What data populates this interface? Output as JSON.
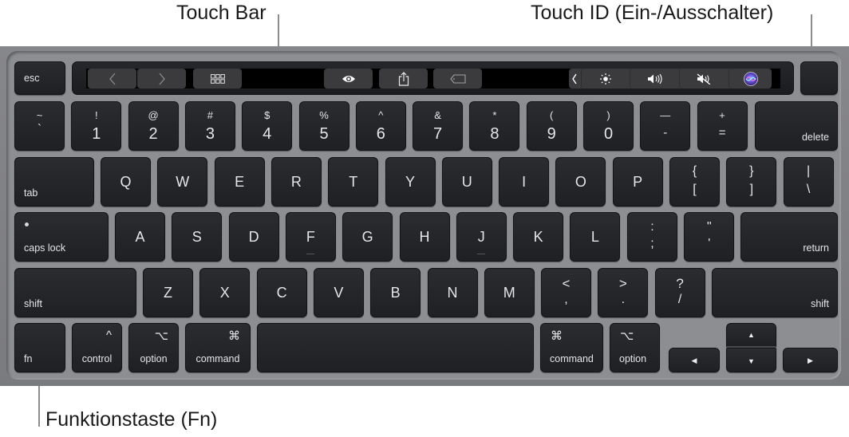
{
  "callouts": {
    "touch_bar": "Touch Bar",
    "touch_id": "Touch ID (Ein-/Ausschalter)",
    "fn_key": "Funktionstaste (Fn)"
  },
  "colors": {
    "key": "#1f2023",
    "frame": "#7d7e82",
    "touchbar_button": "#3b3b3e",
    "callout_text": "#1a1a1a"
  },
  "touch_bar": {
    "esc": "esc",
    "left_buttons": [
      {
        "name": "back",
        "icon": "‹"
      },
      {
        "name": "forward",
        "icon": "›"
      },
      {
        "name": "grid-view",
        "icon": "grid"
      }
    ],
    "middle_buttons": [
      {
        "name": "quick-look",
        "icon": "eye"
      },
      {
        "name": "share",
        "icon": "share"
      },
      {
        "name": "tag",
        "icon": "tag"
      }
    ],
    "control_strip": [
      {
        "name": "collapse",
        "icon": "‹"
      },
      {
        "name": "brightness",
        "icon": "☀"
      },
      {
        "name": "volume",
        "icon": "speaker"
      },
      {
        "name": "mute",
        "icon": "speaker-mute"
      },
      {
        "name": "siri",
        "icon": "siri"
      }
    ],
    "touch_id": ""
  },
  "rows": {
    "numbers": [
      {
        "up": "~",
        "down": "`"
      },
      {
        "up": "!",
        "down": "1"
      },
      {
        "up": "@",
        "down": "2"
      },
      {
        "up": "#",
        "down": "3"
      },
      {
        "up": "$",
        "down": "4"
      },
      {
        "up": "%",
        "down": "5"
      },
      {
        "up": "^",
        "down": "6"
      },
      {
        "up": "&",
        "down": "7"
      },
      {
        "up": "*",
        "down": "8"
      },
      {
        "up": "(",
        "down": "9"
      },
      {
        "up": ")",
        "down": "0"
      },
      {
        "up": "—",
        "down": "-"
      },
      {
        "up": "+",
        "down": "="
      }
    ],
    "delete": "delete",
    "tab": "tab",
    "qwerty": [
      "Q",
      "W",
      "E",
      "R",
      "T",
      "Y",
      "U",
      "I",
      "O",
      "P"
    ],
    "brackets": [
      {
        "up": "{",
        "down": "["
      },
      {
        "up": "}",
        "down": "]"
      },
      {
        "up": "|",
        "down": "\\"
      }
    ],
    "caps_lock": "caps lock",
    "asdf": [
      "A",
      "S",
      "D",
      "F",
      "G",
      "H",
      "J",
      "K",
      "L"
    ],
    "semicolon": {
      "up": ":",
      "down": ";"
    },
    "quote": {
      "up": "\"",
      "down": "'"
    },
    "return": "return",
    "shift_left": "shift",
    "zxcv": [
      "Z",
      "X",
      "C",
      "V",
      "B",
      "N",
      "M"
    ],
    "punct": [
      {
        "up": "<",
        "down": ","
      },
      {
        "up": ">",
        "down": "."
      },
      {
        "up": "?",
        "down": "/"
      }
    ],
    "shift_right": "shift",
    "bottom": {
      "fn": "fn",
      "control": "control",
      "control_symbol": "^",
      "option_left": "option",
      "option_symbol": "⌥",
      "command_left": "command",
      "command_symbol": "⌘",
      "command_right": "command",
      "option_right": "option",
      "arrow_left": "◀",
      "arrow_up": "▲",
      "arrow_down": "▼",
      "arrow_right": "▶"
    }
  }
}
